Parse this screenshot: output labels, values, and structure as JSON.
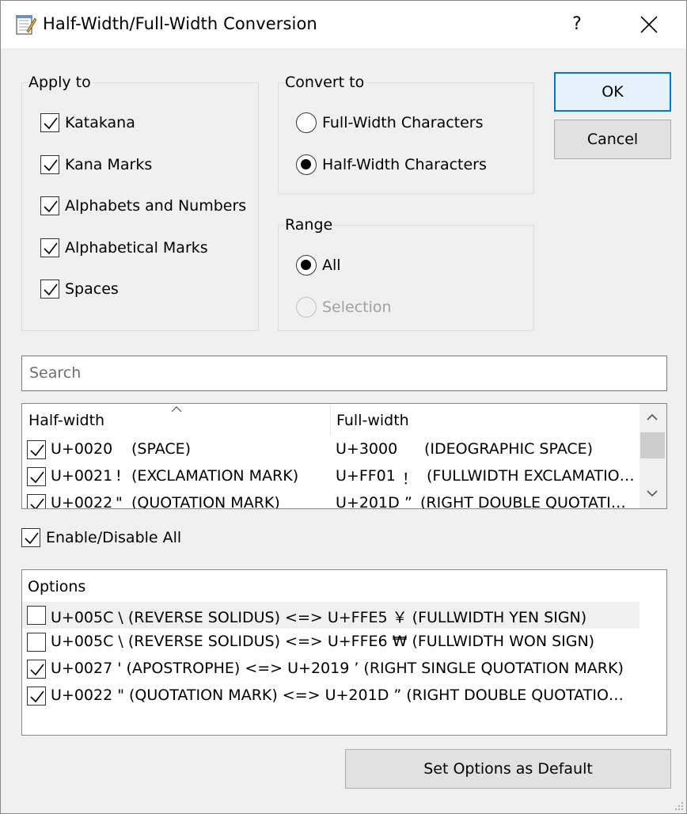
{
  "window": {
    "title": "Half-Width/Full-Width Conversion",
    "help_label": "?",
    "icons": {
      "app": "notepad-icon",
      "close": "close-icon"
    }
  },
  "apply_to": {
    "title": "Apply to",
    "items": [
      {
        "label": "Katakana",
        "checked": true
      },
      {
        "label": "Kana Marks",
        "checked": true
      },
      {
        "label": "Alphabets and Numbers",
        "checked": true
      },
      {
        "label": "Alphabetical Marks",
        "checked": true
      },
      {
        "label": "Spaces",
        "checked": true
      }
    ]
  },
  "convert_to": {
    "title": "Convert to",
    "options": [
      {
        "label": "Full-Width Characters",
        "selected": false
      },
      {
        "label": "Half-Width Characters",
        "selected": true
      }
    ]
  },
  "range": {
    "title": "Range",
    "options": [
      {
        "label": "All",
        "selected": true,
        "enabled": true
      },
      {
        "label": "Selection",
        "selected": false,
        "enabled": false
      }
    ]
  },
  "buttons": {
    "ok": "OK",
    "cancel": "Cancel",
    "set_default": "Set Options as Default"
  },
  "search": {
    "placeholder": "Search"
  },
  "mapping_list": {
    "columns": [
      "Half-width",
      "Full-width"
    ],
    "sort_column": "Half-width",
    "rows": [
      {
        "checked": true,
        "half_code": "U+0020",
        "half_char": "",
        "half_name": "(SPACE)",
        "full_code": "U+3000",
        "full_char": "",
        "full_name": "(IDEOGRAPHIC SPACE)"
      },
      {
        "checked": true,
        "half_code": "U+0021",
        "half_char": "!",
        "half_name": "(EXCLAMATION MARK)",
        "full_code": "U+FF01",
        "full_char": "！",
        "full_name": "(FULLWIDTH EXCLAMATIO…"
      },
      {
        "checked": true,
        "half_code": "U+0022",
        "half_char": "\"",
        "half_name": "(QUOTATION MARK)",
        "full_code": "U+201D",
        "full_char": "”",
        "full_name": "(RIGHT DOUBLE QUOTATI…"
      }
    ]
  },
  "enable_all": {
    "label": "Enable/Disable All",
    "checked": true
  },
  "options": {
    "header": "Options",
    "items": [
      {
        "checked": false,
        "text": "U+005C  \\  (REVERSE SOLIDUS) <=> U+FFE5  ￥  (FULLWIDTH YEN SIGN)",
        "highlighted": true
      },
      {
        "checked": false,
        "text": "U+005C  \\  (REVERSE SOLIDUS) <=> U+FFE6  ₩  (FULLWIDTH WON SIGN)",
        "highlighted": false
      },
      {
        "checked": true,
        "text": "U+0027  '  (APOSTROPHE) <=> U+2019  ’  (RIGHT SINGLE QUOTATION MARK)",
        "highlighted": false
      },
      {
        "checked": true,
        "text": "U+0022  \"  (QUOTATION MARK) <=> U+201D  ”  (RIGHT DOUBLE QUOTATIO…",
        "highlighted": false
      }
    ]
  }
}
